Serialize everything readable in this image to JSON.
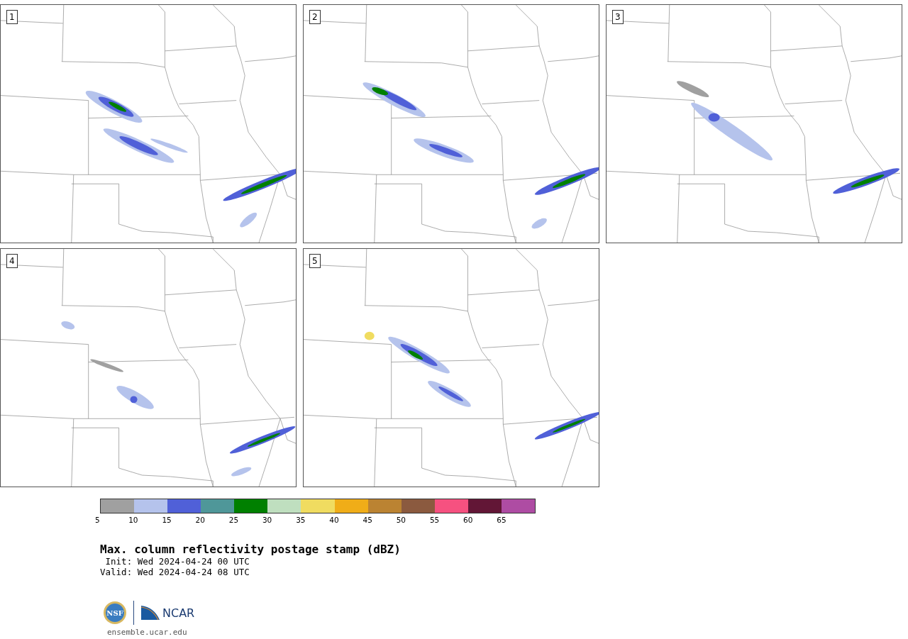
{
  "panels": [
    {
      "label": "1"
    },
    {
      "label": "2"
    },
    {
      "label": "3"
    },
    {
      "label": "4"
    },
    {
      "label": "5"
    }
  ],
  "colorbar": {
    "bins": [
      {
        "color": "#a0a0a0"
      },
      {
        "color": "#b5c3ec"
      },
      {
        "color": "#5060d8"
      },
      {
        "color": "#4f9799"
      },
      {
        "color": "#008000"
      },
      {
        "color": "#bfdfbf"
      },
      {
        "color": "#f0dc60"
      },
      {
        "color": "#f0ad18"
      },
      {
        "color": "#bb8332"
      },
      {
        "color": "#8b5a3f"
      },
      {
        "color": "#f65180"
      },
      {
        "color": "#621636"
      },
      {
        "color": "#ae4ca3"
      }
    ],
    "ticks": [
      "5",
      "10",
      "15",
      "20",
      "25",
      "30",
      "35",
      "40",
      "45",
      "50",
      "55",
      "60",
      "65"
    ]
  },
  "title": "Max. column reflectivity postage stamp (dBZ)",
  "init": " Init: Wed 2024-04-24 00 UTC",
  "valid": "Valid: Wed 2024-04-24 08 UTC",
  "logos": {
    "nsf": "NSF",
    "ncar": "NCAR"
  },
  "url": "ensemble.ucar.edu"
}
